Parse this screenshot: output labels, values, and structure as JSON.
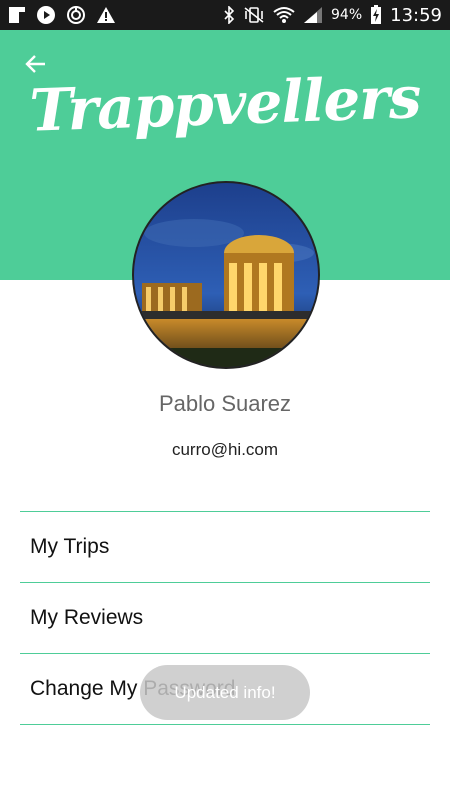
{
  "status_bar": {
    "battery_percent": "94%",
    "time": "13:59",
    "left_icons": [
      "flipboard-icon",
      "play-icon",
      "sync-icon",
      "warning-icon"
    ],
    "right_icons": [
      "bluetooth-icon",
      "vibrate-icon",
      "wifi-icon",
      "signal-icon",
      "battery-icon"
    ]
  },
  "header": {
    "logo_text": "Trappvellers",
    "background_color": "#4ecd98"
  },
  "profile": {
    "name": "Pablo Suarez",
    "email": "curro@hi.com"
  },
  "menu": {
    "items": [
      {
        "label": "My Trips"
      },
      {
        "label": "My Reviews"
      },
      {
        "label": "Change My Password"
      }
    ],
    "divider_color": "#4ecd98"
  },
  "toast": {
    "text": "Updated info!"
  }
}
